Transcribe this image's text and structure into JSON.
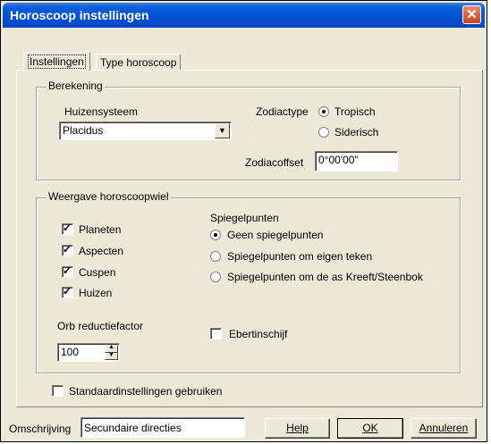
{
  "window": {
    "title": "Horoscoop instellingen",
    "close_glyph": "✕"
  },
  "tabs": [
    {
      "label": "Instellingen",
      "active": true
    },
    {
      "label": "Type horoscoop",
      "active": false
    }
  ],
  "berekening": {
    "legend": "Berekening",
    "huizensysteem_label": "Huizensysteem",
    "huizensysteem_value": "Placidus",
    "zodiactype_label": "Zodiactype",
    "zodiac_options": [
      {
        "label": "Tropisch",
        "selected": true
      },
      {
        "label": "Siderisch",
        "selected": false
      }
    ],
    "zodiacoffset_label": "Zodiacoffset",
    "zodiacoffset_value": "0°00'00\""
  },
  "weergave": {
    "legend": "Weergave horoscoopwiel",
    "checkboxes": [
      {
        "label": "Planeten",
        "checked": true
      },
      {
        "label": "Aspecten",
        "checked": true
      },
      {
        "label": "Cuspen",
        "checked": true
      },
      {
        "label": "Huizen",
        "checked": true
      }
    ],
    "spiegelpunten_label": "Spiegelpunten",
    "spiegelpunten_options": [
      {
        "label": "Geen spiegelpunten",
        "selected": true
      },
      {
        "label": "Spiegelpunten om eigen teken",
        "selected": false
      },
      {
        "label": "Spiegelpunten om de as Kreeft/Steenbok",
        "selected": false
      }
    ],
    "orb_label": "Orb reductiefactor",
    "orb_value": "100",
    "ebertin_label": "Ebertinschijf",
    "ebertin_checked": false
  },
  "standaard": {
    "label": "Standaardinstellingen gebruiken",
    "checked": false
  },
  "footer": {
    "omschrijving_label": "Omschrijving",
    "omschrijving_value": "Secundaire directies",
    "help_label": "Help",
    "ok_label": "OK",
    "annuleren_label": "Annuleren"
  },
  "glyphs": {
    "check": "✓",
    "dropdown_arrow": "▼",
    "spin_up": "▲",
    "spin_down": "▼"
  }
}
